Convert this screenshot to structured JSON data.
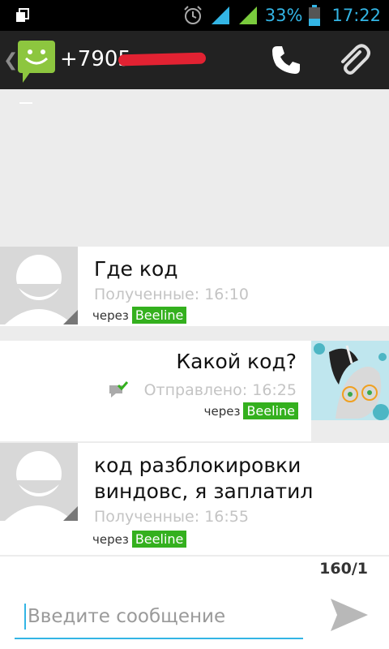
{
  "status_bar": {
    "battery": "33%",
    "time": "17:22"
  },
  "header": {
    "contact": "+7905"
  },
  "messages": [
    {
      "text": "Где код",
      "status": "Полученные: 16:10",
      "via": "через",
      "carrier": "Beeline"
    },
    {
      "text": "Какой код?",
      "status": "Отправлено: 16:25",
      "via": "через",
      "carrier": "Beeline"
    },
    {
      "text_line1": "код разблокировки",
      "text_line2": "виндовс, я заплатил",
      "status": "Полученные: 16:55",
      "via": "через",
      "carrier": "Beeline"
    }
  ],
  "composer": {
    "counter": "160/1",
    "placeholder": "Введите сообщение"
  },
  "colors": {
    "accent": "#33b5e5",
    "carrier_badge": "#34b01e",
    "action_bar": "#222222"
  }
}
